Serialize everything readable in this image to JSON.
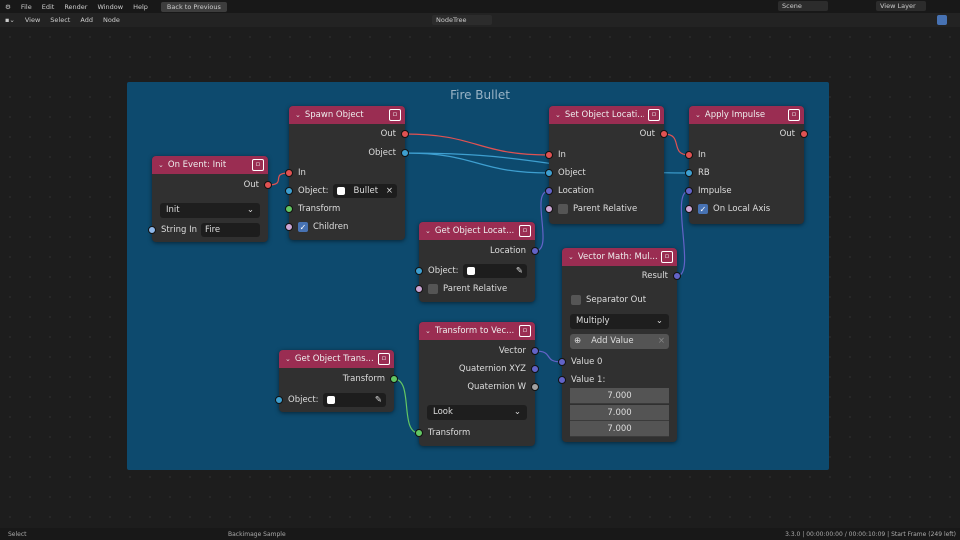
{
  "topbar": {
    "menus": [
      "File",
      "Edit",
      "Render",
      "Window",
      "Help"
    ],
    "back_button": "Back to Previous",
    "scene": "Scene",
    "view_layer": "View Layer"
  },
  "editor_header": {
    "menus": [
      "View",
      "Select",
      "Add",
      "Node"
    ],
    "node_tree": "NodeTree"
  },
  "frame": {
    "title": "Fire Bullet",
    "color": "#0d4a6e"
  },
  "socket_colors": {
    "logic": "#e05252",
    "object": "#3e9fd0",
    "vector": "#6363c7",
    "bool": "#cca6d6",
    "transform": "#63c763",
    "float": "#a1a1a1",
    "string": "#8fb7e8"
  },
  "header_color": "#9a2d52",
  "nodes": {
    "on_event": {
      "title": "On Event: Init",
      "icon": "event-icon",
      "rows": [
        {
          "kind": "out",
          "label": "Out",
          "socket": "logic"
        },
        {
          "kind": "select",
          "label": "Init"
        },
        {
          "kind": "in-field",
          "label": "String In",
          "value": "Fire",
          "socket": "string"
        }
      ]
    },
    "spawn": {
      "title": "Spawn Object",
      "icon": "object-icon",
      "rows": [
        {
          "kind": "out",
          "label": "Out",
          "socket": "logic"
        },
        {
          "kind": "out",
          "label": "Object",
          "socket": "object"
        },
        {
          "kind": "in",
          "label": "In",
          "socket": "logic"
        },
        {
          "kind": "in-field",
          "label": "Object:",
          "value": "Bullet",
          "socket": "object",
          "clear": "×"
        },
        {
          "kind": "in",
          "label": "Transform",
          "socket": "transform"
        },
        {
          "kind": "in-check",
          "label": "Children",
          "checked": true,
          "socket": "bool"
        }
      ]
    },
    "get_loc": {
      "title": "Get Object Locat...",
      "icon": "object-icon",
      "rows": [
        {
          "kind": "out",
          "label": "Location",
          "socket": "vector"
        },
        {
          "kind": "in-field",
          "label": "Object:",
          "value": "",
          "socket": "object",
          "clear": "✎"
        },
        {
          "kind": "in-check",
          "label": "Parent Relative",
          "checked": false,
          "socket": "bool"
        }
      ]
    },
    "set_loc": {
      "title": "Set Object Locati...",
      "icon": "object-icon",
      "rows": [
        {
          "kind": "out",
          "label": "Out",
          "socket": "logic"
        },
        {
          "kind": "in",
          "label": "In",
          "socket": "logic"
        },
        {
          "kind": "in",
          "label": "Object",
          "socket": "object"
        },
        {
          "kind": "in",
          "label": "Location",
          "socket": "vector"
        },
        {
          "kind": "in-check",
          "label": "Parent Relative",
          "checked": false,
          "socket": "bool"
        }
      ]
    },
    "impulse": {
      "title": "Apply Impulse",
      "icon": "physics-icon",
      "rows": [
        {
          "kind": "out",
          "label": "Out",
          "socket": "logic"
        },
        {
          "kind": "in",
          "label": "In",
          "socket": "logic"
        },
        {
          "kind": "in",
          "label": "RB",
          "socket": "object"
        },
        {
          "kind": "in",
          "label": "Impulse",
          "socket": "vector"
        },
        {
          "kind": "in-check",
          "label": "On Local Axis",
          "checked": true,
          "socket": "bool"
        }
      ]
    },
    "vecmath": {
      "title": "Vector Math: Mul...",
      "icon": "math-icon",
      "rows": [
        {
          "kind": "out",
          "label": "Result",
          "socket": "vector"
        },
        {
          "kind": "check",
          "label": "Separator Out",
          "checked": false
        },
        {
          "kind": "select",
          "label": "Multiply"
        },
        {
          "kind": "button",
          "label": "Add Value"
        },
        {
          "kind": "in",
          "label": "Value 0",
          "socket": "vector"
        },
        {
          "kind": "in",
          "label": "Value 1:",
          "socket": "vector"
        },
        {
          "kind": "number",
          "label": "7.000"
        },
        {
          "kind": "number",
          "label": "7.000"
        },
        {
          "kind": "number",
          "label": "7.000"
        }
      ]
    },
    "to_vec": {
      "title": "Transform to Vec...",
      "icon": "object-icon",
      "rows": [
        {
          "kind": "out",
          "label": "Vector",
          "socket": "vector"
        },
        {
          "kind": "out",
          "label": "Quaternion XYZ",
          "socket": "vector"
        },
        {
          "kind": "out",
          "label": "Quaternion W",
          "socket": "float"
        },
        {
          "kind": "select",
          "label": "Look"
        },
        {
          "kind": "in",
          "label": "Transform",
          "socket": "transform"
        }
      ]
    },
    "get_trans": {
      "title": "Get Object Trans...",
      "icon": "object-icon",
      "rows": [
        {
          "kind": "out",
          "label": "Transform",
          "socket": "transform"
        },
        {
          "kind": "in-field",
          "label": "Object:",
          "value": "",
          "socket": "object",
          "clear": "✎"
        }
      ]
    }
  },
  "status": {
    "left": "Select",
    "middle": "Backimage Sample",
    "right": "3.3.0 | 00:00:00:00 / 00:00:10:09 | Start Frame (249 left)"
  }
}
